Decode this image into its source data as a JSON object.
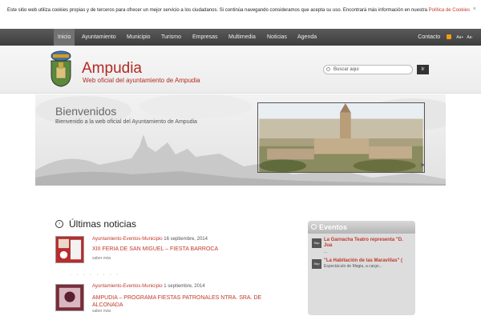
{
  "cookie": {
    "text": "Este sitio web utiliza cookies propias y de terceros para ofrecer un mejor servicio a los ciudadanos. Si continúa navegando consideramos que acepta su uso. Encontrará más información en nuestra ",
    "link": "Política de Cookies",
    "close": "×"
  },
  "nav": {
    "items": [
      "Inicio",
      "Ayuntamiento",
      "Municipio",
      "Turismo",
      "Empresas",
      "Multimedia",
      "Noticias",
      "Agenda"
    ],
    "contact": "Contacto",
    "font_larger": "Aa+",
    "font_smaller": "Aa-"
  },
  "header": {
    "title": "Ampudia",
    "subtitle": "Web oficial del ayuntamiento de Ampudia",
    "search_placeholder": "Buscar aqui",
    "search_button": "Ir"
  },
  "hero": {
    "title": "Bienvenidos",
    "subtitle": "Bienvenido a la web oficial del Ayuntamiento de Ampudia",
    "prev": "◀",
    "next": "▶"
  },
  "news": {
    "section_title": "Últimas noticias",
    "section_icon": "arrow-circle-icon",
    "items": [
      {
        "category": "Ayuntamiento-Eventos-Municipio",
        "date": "16 septiembre, 2014",
        "title": "XIII FERIA DE SAN MIGUEL – FIESTA BARROCA",
        "more": "saber más"
      },
      {
        "category": "Ayuntamiento-Eventos-Municipio",
        "date": "1 septiembre, 2014",
        "title": "AMPUDIA – PROGRAMA FIESTAS PATRONALES NTRA. SRA. DE ALCONADA",
        "more": "saber más"
      }
    ],
    "separator": "· · · · · · · ·"
  },
  "events": {
    "title": "Eventos",
    "items": [
      {
        "title": "La Garnacha Teatro representa \"D. Jua",
        "date_label": "Sep",
        "snippet": "..."
      },
      {
        "title": "\"La Habitación de las Maravillas\" (",
        "date_label": "Sep",
        "snippet": "Espectáculo de Magia, a cargo..."
      }
    ]
  },
  "colors": {
    "brand_red": "#b32a22",
    "nav_bg": "#4a4a4a",
    "accent_orange": "#f39c12"
  }
}
